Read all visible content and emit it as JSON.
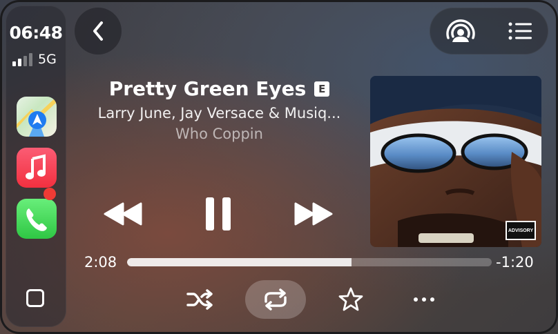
{
  "status_bar": {
    "time": "06:48",
    "network": "5G",
    "signal_bars": 2,
    "signal_max": 4
  },
  "dock": {
    "apps": [
      {
        "name": "Maps",
        "icon": "maps-icon"
      },
      {
        "name": "Music",
        "icon": "music-icon"
      },
      {
        "name": "Phone",
        "icon": "phone-icon",
        "has_badge": true
      }
    ],
    "home_icon": "home-square-icon"
  },
  "header": {
    "back_icon": "chevron-left-icon",
    "cast_icon": "airplay-icon",
    "queue_icon": "list-icon"
  },
  "track": {
    "title": "Pretty Green Eyes",
    "explicit_badge": "E",
    "artists": "Larry June, Jay Versace & Musiq...",
    "album": "Who Coppin"
  },
  "artwork": {
    "parental_advisory": "PARENTAL ADVISORY EXPLICIT CONTENT"
  },
  "playback": {
    "elapsed": "2:08",
    "remaining": "-1:20",
    "progress_fraction": 0.615,
    "state": "playing"
  },
  "actions": {
    "shuffle_icon": "shuffle-icon",
    "repeat_icon": "repeat-icon",
    "repeat_active": true,
    "favorite_icon": "star-icon",
    "more_icon": "ellipsis-icon"
  }
}
